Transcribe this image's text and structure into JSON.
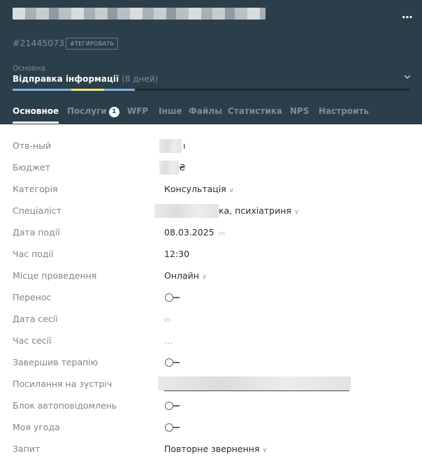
{
  "header": {
    "menu_label": "...",
    "deal_id": "#21445073",
    "tag_button": "#ТЕГИРОВАТЬ",
    "pipeline_name": "Основна",
    "stage_name": "Відправка інформації",
    "stage_duration": "(8 дней)",
    "expand_icon": "chevron-down-icon",
    "progress_colors": [
      "#7fb2e5",
      "#f5ea7a",
      "#7fb2e5"
    ]
  },
  "tabs": [
    {
      "label": "Основное",
      "active": true
    },
    {
      "label": "Послуги",
      "badge": "1"
    },
    {
      "label": "WFP"
    },
    {
      "label": "Інше"
    },
    {
      "label": "Файлы"
    },
    {
      "label": "Статистика"
    },
    {
      "label": "NPS"
    },
    {
      "label": "Настроить"
    }
  ],
  "fields": [
    {
      "label": "Отв-ный",
      "value": "ı"
    },
    {
      "label": "Бюджет",
      "value": "₴"
    },
    {
      "label": "Категорія",
      "value": "Консультація"
    },
    {
      "label": "Спеціаліст",
      "value": "ка, психіатриня"
    },
    {
      "label": "Дата події",
      "value": "08.03.2025"
    },
    {
      "label": "Час події",
      "value": "12:30"
    },
    {
      "label": "Місце проведення",
      "value": "Онлайн"
    },
    {
      "label": "Перенос"
    },
    {
      "label": "Дата сесії"
    },
    {
      "label": "Час сесії",
      "value": "..."
    },
    {
      "label": "Завершив терапію"
    },
    {
      "label": "Посилання на зустріч"
    },
    {
      "label": "Блок автоповідомлень"
    },
    {
      "label": "Моя угода"
    },
    {
      "label": "Запит",
      "value": "Повторне звернення"
    }
  ],
  "icons": {
    "dropdown": "chevron-down-icon",
    "calendar": "calendar-icon",
    "toggle": "toggle-off-icon"
  }
}
